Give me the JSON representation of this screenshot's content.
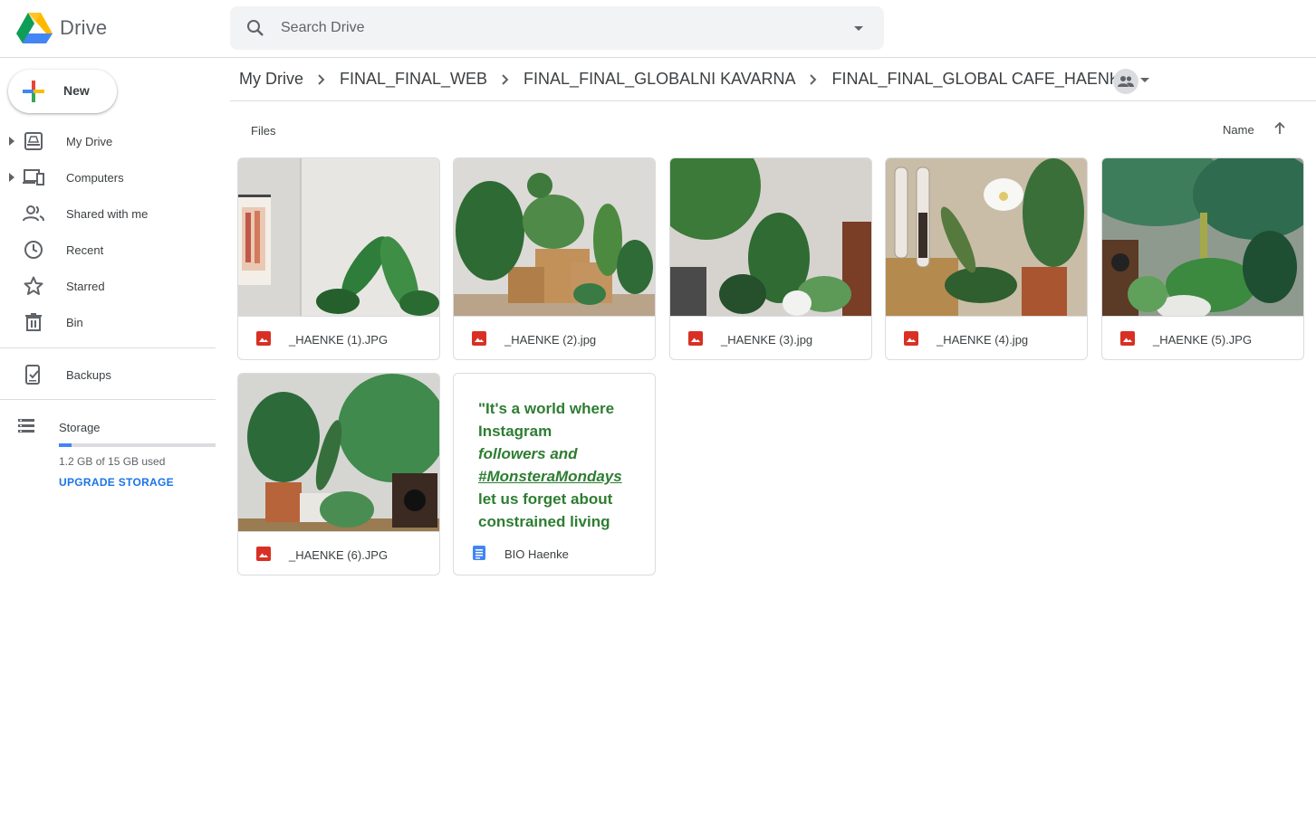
{
  "app": {
    "brand": "Drive"
  },
  "search": {
    "placeholder": "Search Drive"
  },
  "sidebar": {
    "new_label": "New",
    "items": [
      {
        "label": "My Drive",
        "icon": "my-drive-icon",
        "expandable": true
      },
      {
        "label": "Computers",
        "icon": "computers-icon",
        "expandable": true
      },
      {
        "label": "Shared with me",
        "icon": "shared-icon",
        "expandable": false
      },
      {
        "label": "Recent",
        "icon": "clock-icon",
        "expandable": false
      },
      {
        "label": "Starred",
        "icon": "star-icon",
        "expandable": false
      },
      {
        "label": "Bin",
        "icon": "trash-icon",
        "expandable": false
      }
    ],
    "backups_label": "Backups",
    "storage": {
      "label": "Storage",
      "used_text": "1.2 GB of 15 GB used",
      "used_fraction": 0.08,
      "upgrade_label": "UPGRADE STORAGE"
    }
  },
  "breadcrumb": [
    "My Drive",
    "FINAL_FINAL_WEB",
    "FINAL_FINAL_GLOBALNI KAVARNA",
    "FINAL_FINAL_GLOBAL CAFE_HAENKE"
  ],
  "files_header": {
    "label": "Files",
    "sort_label": "Name",
    "sort_direction": "ascending"
  },
  "files": [
    {
      "name": "_HAENKE (1).JPG",
      "type": "image"
    },
    {
      "name": "_HAENKE (2).jpg",
      "type": "image"
    },
    {
      "name": "_HAENKE (3).jpg",
      "type": "image"
    },
    {
      "name": "_HAENKE (4).jpg",
      "type": "image"
    },
    {
      "name": "_HAENKE (5).JPG",
      "type": "image"
    },
    {
      "name": "_HAENKE (6).JPG",
      "type": "image"
    },
    {
      "name": "BIO Haenke",
      "type": "document",
      "preview_lines": [
        "\"It's a world where",
        "Instagram",
        "followers and",
        "#MonsteraMondays",
        "let us forget about",
        "constrained living"
      ]
    }
  ],
  "colors": {
    "accent": "#1a73e8",
    "image_icon": "#d93025",
    "doc_icon": "#4285f4",
    "doc_preview_text": "#2e7d32"
  }
}
